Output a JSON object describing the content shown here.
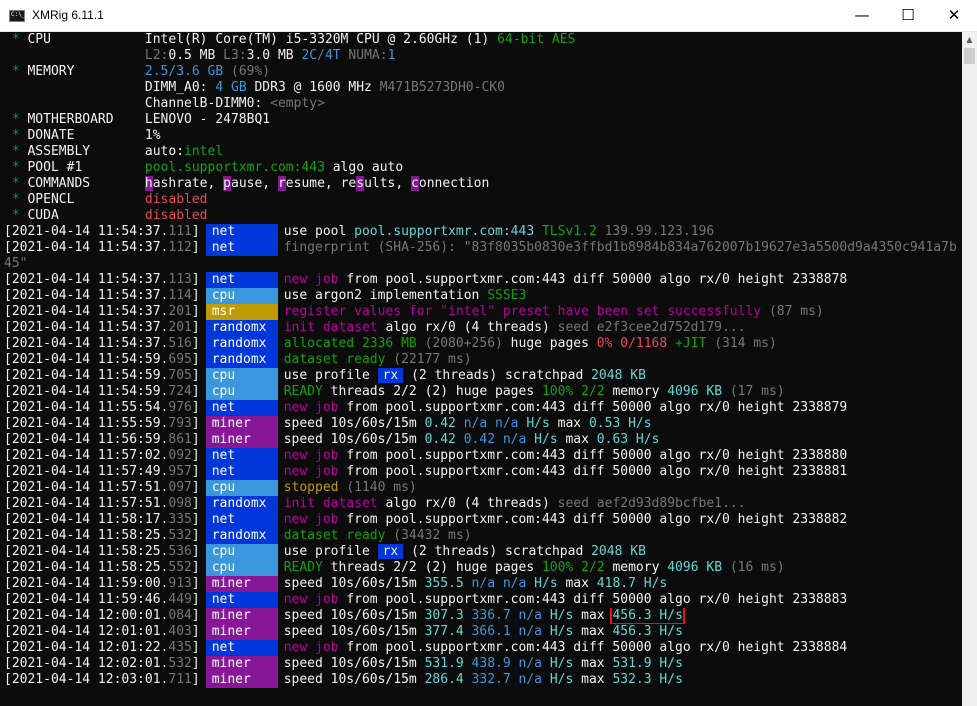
{
  "window": {
    "title": "XMRig 6.11.1",
    "min_glyph": "—",
    "max_glyph": "☐",
    "close_glyph": "✕",
    "icon": "console-icon"
  },
  "scrollbar": {
    "up_glyph": "▲"
  },
  "summary": [
    {
      "star": " * ",
      "key": "CPU            ",
      "parts": [
        [
          "w",
          "Intel(R) Core(TM) i5-3320M CPU @ 2.60GHz (1) "
        ],
        [
          "g",
          "64-bit AES"
        ]
      ]
    },
    {
      "star": "   ",
      "key": "               ",
      "parts": [
        [
          "d",
          "L2:"
        ],
        [
          "w",
          "0.5 MB "
        ],
        [
          "d",
          "L3:"
        ],
        [
          "w",
          "3.0 MB "
        ],
        [
          "c",
          "2C"
        ],
        [
          "d",
          "/"
        ],
        [
          "c",
          "4T "
        ],
        [
          "d",
          "NUMA:"
        ],
        [
          "c",
          "1"
        ]
      ]
    },
    {
      "star": " * ",
      "key": "MEMORY         ",
      "parts": [
        [
          "c",
          "2.5/3.6 "
        ],
        [
          "c",
          "GB "
        ],
        [
          "d",
          "(69%)"
        ]
      ]
    },
    {
      "star": "   ",
      "key": "               ",
      "parts": [
        [
          "w",
          "DIMM_A0: "
        ],
        [
          "c",
          "4 "
        ],
        [
          "c",
          "GB "
        ],
        [
          "w",
          "DDR3 @ 1600 MHz "
        ],
        [
          "d",
          "M471B5273DH0-CK0"
        ]
      ]
    },
    {
      "star": "   ",
      "key": "               ",
      "parts": [
        [
          "w",
          "ChannelB-DIMM0: "
        ],
        [
          "d",
          "<empty>"
        ]
      ]
    },
    {
      "star": " * ",
      "key": "MOTHERBOARD    ",
      "parts": [
        [
          "w",
          "LENOVO - 2478BQ1"
        ]
      ]
    },
    {
      "star": " * ",
      "key": "DONATE         ",
      "parts": [
        [
          "w",
          "1%"
        ]
      ]
    },
    {
      "star": " * ",
      "key": "ASSEMBLY       ",
      "parts": [
        [
          "w",
          "auto:"
        ],
        [
          "g",
          "intel"
        ]
      ]
    },
    {
      "star": " * ",
      "key": "POOL #1        ",
      "parts": [
        [
          "g",
          "pool.supportxmr.com:443 "
        ],
        [
          "w",
          "algo auto"
        ]
      ]
    },
    {
      "star": " * ",
      "key": "COMMANDS       ",
      "parts": [
        [
          "h",
          "h"
        ],
        [
          "w",
          "ashrate, "
        ],
        [
          "h",
          "p"
        ],
        [
          "w",
          "ause, "
        ],
        [
          "h",
          "r"
        ],
        [
          "w",
          "esume, re"
        ],
        [
          "h",
          "s"
        ],
        [
          "w",
          "ults, "
        ],
        [
          "h",
          "c"
        ],
        [
          "w",
          "onnection"
        ]
      ]
    },
    {
      "star": " * ",
      "key": "OPENCL         ",
      "parts": [
        [
          "r",
          "disabled"
        ]
      ]
    },
    {
      "star": " * ",
      "key": "CUDA           ",
      "parts": [
        [
          "r",
          "disabled"
        ]
      ]
    }
  ],
  "log": [
    {
      "d": "2021-04-14 11:54:37",
      "ms": "111",
      "tag": "net",
      "parts": [
        [
          "w",
          "use pool "
        ],
        [
          "cb",
          "pool.supportxmr.com:443 "
        ],
        [
          "g",
          "TLSv1.2 "
        ],
        [
          "d",
          "139.99.123.196"
        ]
      ]
    },
    {
      "d": "2021-04-14 11:54:37",
      "ms": "112",
      "tag": "net",
      "tall": true,
      "parts": [
        [
          "d",
          "fingerprint (SHA-256): \"83f8035b0830e3ffbd1b8984b834a762007b19627e3a5500d9a4350c941a7b45\""
        ]
      ]
    },
    {
      "d": "2021-04-14 11:54:37",
      "ms": "113",
      "tag": "net",
      "parts": [
        [
          "m",
          "new job "
        ],
        [
          "w",
          "from pool.supportxmr.com:443 diff 50000 algo rx/0 height 2338878"
        ]
      ]
    },
    {
      "d": "2021-04-14 11:54:37",
      "ms": "114",
      "tag": "cpu",
      "parts": [
        [
          "w",
          "use argon2 implementation "
        ],
        [
          "g",
          "SSSE3"
        ]
      ]
    },
    {
      "d": "2021-04-14 11:54:37",
      "ms": "201",
      "tag": "msr",
      "parts": [
        [
          "m",
          "register values for \"intel\" preset have been set successfully "
        ],
        [
          "d",
          "(87 ms)"
        ]
      ]
    },
    {
      "d": "2021-04-14 11:54:37",
      "ms": "201",
      "tag": "randomx",
      "parts": [
        [
          "m",
          "init dataset "
        ],
        [
          "w",
          "algo rx/0 (4 threads) "
        ],
        [
          "d",
          "seed e2f3cee2d752d179..."
        ]
      ]
    },
    {
      "d": "2021-04-14 11:54:37",
      "ms": "516",
      "tag": "randomx",
      "parts": [
        [
          "g",
          "allocated 2336 MB "
        ],
        [
          "d",
          "(2080+256) "
        ],
        [
          "w",
          "huge pages "
        ],
        [
          "r",
          "0% 0/1168 "
        ],
        [
          "g",
          "+JIT "
        ],
        [
          "d",
          "(314 ms)"
        ]
      ]
    },
    {
      "d": "2021-04-14 11:54:59",
      "ms": "695",
      "tag": "randomx",
      "parts": [
        [
          "g",
          "dataset ready "
        ],
        [
          "d",
          "(22177 ms)"
        ]
      ]
    },
    {
      "d": "2021-04-14 11:54:59",
      "ms": "705",
      "tag": "cpu",
      "parts": [
        [
          "w",
          "use profile "
        ],
        [
          "p",
          "rx"
        ],
        [
          "w",
          " (2 threads) scratchpad "
        ],
        [
          "cb",
          "2048 KB"
        ]
      ]
    },
    {
      "d": "2021-04-14 11:54:59",
      "ms": "724",
      "tag": "cpu",
      "parts": [
        [
          "g",
          "READY "
        ],
        [
          "w",
          "threads 2/2 (2) huge pages "
        ],
        [
          "g",
          "100% 2/2 "
        ],
        [
          "w",
          "memory "
        ],
        [
          "cb",
          "4096 KB "
        ],
        [
          "d",
          "(17 ms)"
        ]
      ]
    },
    {
      "d": "2021-04-14 11:55:54",
      "ms": "976",
      "tag": "net",
      "parts": [
        [
          "m",
          "new job "
        ],
        [
          "w",
          "from pool.supportxmr.com:443 diff 50000 algo rx/0 height 2338879"
        ]
      ]
    },
    {
      "d": "2021-04-14 11:55:59",
      "ms": "793",
      "tag": "miner",
      "parts": [
        [
          "w",
          "speed 10s/60s/15m "
        ],
        [
          "cb",
          "0.42 "
        ],
        [
          "c",
          "n/a n/a "
        ],
        [
          "cb",
          "H/s "
        ],
        [
          "w",
          "max "
        ],
        [
          "cb",
          "0.53 H/s"
        ]
      ]
    },
    {
      "d": "2021-04-14 11:56:59",
      "ms": "861",
      "tag": "miner",
      "parts": [
        [
          "w",
          "speed 10s/60s/15m "
        ],
        [
          "cb",
          "0.42 "
        ],
        [
          "c",
          "0.42 n/a "
        ],
        [
          "cb",
          "H/s "
        ],
        [
          "w",
          "max "
        ],
        [
          "cb",
          "0.63 H/s"
        ]
      ]
    },
    {
      "d": "2021-04-14 11:57:02",
      "ms": "092",
      "tag": "net",
      "parts": [
        [
          "m",
          "new job "
        ],
        [
          "w",
          "from pool.supportxmr.com:443 diff 50000 algo rx/0 height 2338880"
        ]
      ]
    },
    {
      "d": "2021-04-14 11:57:49",
      "ms": "957",
      "tag": "net",
      "parts": [
        [
          "m",
          "new job "
        ],
        [
          "w",
          "from pool.supportxmr.com:443 diff 50000 algo rx/0 height 2338881"
        ]
      ]
    },
    {
      "d": "2021-04-14 11:57:51",
      "ms": "097",
      "tag": "cpu",
      "parts": [
        [
          "y",
          "stopped "
        ],
        [
          "d",
          "(1140 ms)"
        ]
      ]
    },
    {
      "d": "2021-04-14 11:57:51",
      "ms": "098",
      "tag": "randomx",
      "parts": [
        [
          "m",
          "init dataset "
        ],
        [
          "w",
          "algo rx/0 (4 threads) "
        ],
        [
          "d",
          "seed aef2d93d89bcfbe1..."
        ]
      ]
    },
    {
      "d": "2021-04-14 11:58:17",
      "ms": "335",
      "tag": "net",
      "parts": [
        [
          "m",
          "new job "
        ],
        [
          "w",
          "from pool.supportxmr.com:443 diff 50000 algo rx/0 height 2338882"
        ]
      ]
    },
    {
      "d": "2021-04-14 11:58:25",
      "ms": "532",
      "tag": "randomx",
      "parts": [
        [
          "g",
          "dataset ready "
        ],
        [
          "d",
          "(34432 ms)"
        ]
      ]
    },
    {
      "d": "2021-04-14 11:58:25",
      "ms": "536",
      "tag": "cpu",
      "parts": [
        [
          "w",
          "use profile "
        ],
        [
          "p",
          "rx"
        ],
        [
          "w",
          " (2 threads) scratchpad "
        ],
        [
          "cb",
          "2048 KB"
        ]
      ]
    },
    {
      "d": "2021-04-14 11:58:25",
      "ms": "552",
      "tag": "cpu",
      "parts": [
        [
          "g",
          "READY "
        ],
        [
          "w",
          "threads 2/2 (2) huge pages "
        ],
        [
          "g",
          "100% 2/2 "
        ],
        [
          "w",
          "memory "
        ],
        [
          "cb",
          "4096 KB "
        ],
        [
          "d",
          "(16 ms)"
        ]
      ]
    },
    {
      "d": "2021-04-14 11:59:00",
      "ms": "913",
      "tag": "miner",
      "parts": [
        [
          "w",
          "speed 10s/60s/15m "
        ],
        [
          "cb",
          "355.5 "
        ],
        [
          "c",
          "n/a n/a "
        ],
        [
          "cb",
          "H/s "
        ],
        [
          "w",
          "max "
        ],
        [
          "cb",
          "418.7 H/s"
        ]
      ]
    },
    {
      "d": "2021-04-14 11:59:46",
      "ms": "449",
      "tag": "net",
      "parts": [
        [
          "m",
          "new job "
        ],
        [
          "w",
          "from pool.supportxmr.com:443 diff 50000 algo rx/0 height 2338883"
        ]
      ]
    },
    {
      "d": "2021-04-14 12:00:01",
      "ms": "084",
      "tag": "miner",
      "parts": [
        [
          "w",
          "speed 10s/60s/15m "
        ],
        [
          "cb",
          "307.3 "
        ],
        [
          "c",
          "336.7 n/a "
        ],
        [
          "cb",
          "H/s "
        ],
        [
          "w",
          "max "
        ],
        [
          "bx",
          "456.3 H/s"
        ]
      ]
    },
    {
      "d": "2021-04-14 12:01:01",
      "ms": "403",
      "tag": "miner",
      "parts": [
        [
          "w",
          "speed 10s/60s/15m "
        ],
        [
          "cb",
          "377.4 "
        ],
        [
          "c",
          "366.1 n/a "
        ],
        [
          "cb",
          "H/s "
        ],
        [
          "w",
          "max "
        ],
        [
          "cb",
          "456.3 H/s"
        ]
      ]
    },
    {
      "d": "2021-04-14 12:01:22",
      "ms": "435",
      "tag": "net",
      "parts": [
        [
          "m",
          "new job "
        ],
        [
          "w",
          "from pool.supportxmr.com:443 diff 50000 algo rx/0 height 2338884"
        ]
      ]
    },
    {
      "d": "2021-04-14 12:02:01",
      "ms": "532",
      "tag": "miner",
      "parts": [
        [
          "w",
          "speed 10s/60s/15m "
        ],
        [
          "cb",
          "531.9 "
        ],
        [
          "c",
          "438.9 n/a "
        ],
        [
          "cb",
          "H/s "
        ],
        [
          "w",
          "max "
        ],
        [
          "cb",
          "531.9 H/s"
        ]
      ]
    },
    {
      "d": "2021-04-14 12:03:01",
      "ms": "711",
      "tag": "miner",
      "parts": [
        [
          "w",
          "speed 10s/60s/15m "
        ],
        [
          "cb",
          "286.4 "
        ],
        [
          "c",
          "332.7 n/a "
        ],
        [
          "cb",
          "H/s "
        ],
        [
          "w",
          "max "
        ],
        [
          "cb",
          "532.3 H/s"
        ]
      ]
    }
  ]
}
